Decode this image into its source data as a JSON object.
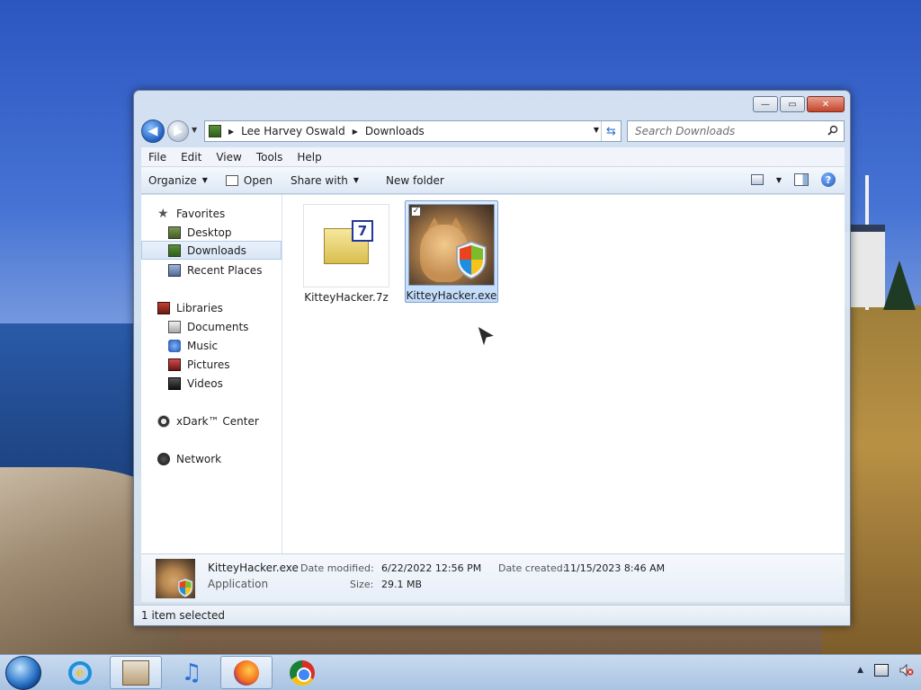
{
  "window": {
    "caption_buttons": {
      "minimize": "—",
      "maximize": "▭",
      "close": "✕"
    }
  },
  "nav": {
    "back": "◀",
    "forward": "▶",
    "history": "▼",
    "breadcrumb": [
      "Lee Harvey Oswald",
      "Downloads"
    ],
    "breadcrumb_sep": "▶",
    "address_dropdown": "▼",
    "refresh": "⇆",
    "search_placeholder": "Search Downloads"
  },
  "menubar": [
    "File",
    "Edit",
    "View",
    "Tools",
    "Help"
  ],
  "toolbar": {
    "organize": "Organize",
    "open": "Open",
    "share_with": "Share with",
    "new_folder": "New folder",
    "dropdown": "▼",
    "help": "?"
  },
  "sidebar": {
    "favorites": "Favorites",
    "favorites_items": [
      "Desktop",
      "Downloads",
      "Recent Places"
    ],
    "libraries": "Libraries",
    "libraries_items": [
      "Documents",
      "Music",
      "Pictures",
      "Videos"
    ],
    "xdark": "xDark™ Center",
    "network": "Network",
    "selected": "Downloads"
  },
  "files": [
    {
      "name": "KitteyHacker.7z",
      "icon": "archive-icon",
      "badge": "7"
    },
    {
      "name": "KitteyHacker.exe",
      "icon": "cat-shield-thumbnail",
      "checked": "✓"
    }
  ],
  "details": {
    "name": "KitteyHacker.exe",
    "type": "Application",
    "date_modified_label": "Date modified:",
    "date_modified": "6/22/2022 12:56 PM",
    "date_created_label": "Date created:",
    "date_created": "11/15/2023 8:46 AM",
    "size_label": "Size:",
    "size": "29.1 MB"
  },
  "status": {
    "text": "1 item selected"
  },
  "taskbar": {
    "ie_letter": "e",
    "music_glyph": "♫",
    "tray_arrow": "▲",
    "colors": {
      "accent": "#2a72d8",
      "selection": "#c1dcfc"
    }
  }
}
